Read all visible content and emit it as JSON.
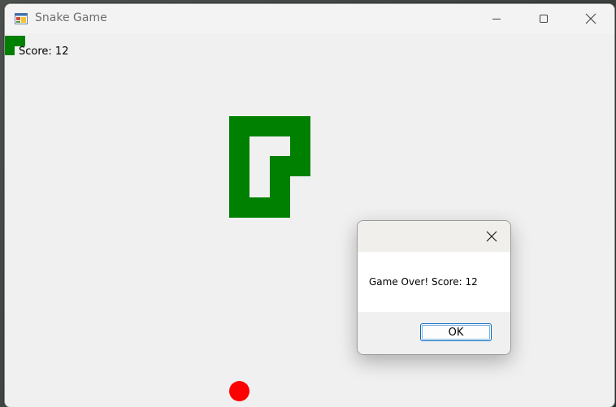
{
  "window": {
    "title": "Snake Game",
    "icon": "winforms-app-icon",
    "controls": [
      "minimize-icon",
      "maximize-icon",
      "close-icon"
    ]
  },
  "game": {
    "score_text": "Score: 12",
    "score": 12,
    "snake_color": "#008000",
    "food_color": "#ff0000",
    "background_color": "#f0f0f0"
  },
  "dialog": {
    "message": "Game Over! Score: 12",
    "ok_label": "OK",
    "close_icon": "close-icon"
  }
}
